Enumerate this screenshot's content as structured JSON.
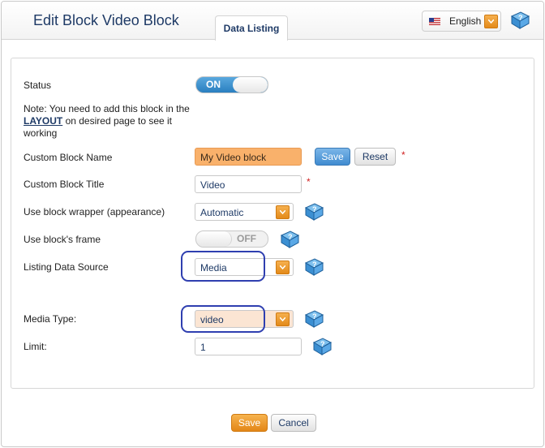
{
  "header": {
    "title": "Edit Block Video Block",
    "tab_label": "Data Listing",
    "language": {
      "label": "English",
      "flag": "us-flag-icon"
    }
  },
  "form": {
    "status": {
      "label": "Status",
      "value": "ON"
    },
    "note": {
      "prefix": "Note: You need to add this block in the",
      "link_text": "LAYOUT",
      "suffix": "on desired page to see it working"
    },
    "block_name": {
      "label": "Custom Block Name",
      "value": "My Video block",
      "save_label": "Save",
      "reset_label": "Reset",
      "required_mark": "*"
    },
    "block_title": {
      "label": "Custom Block Title",
      "value": "Video",
      "required_mark": "*"
    },
    "wrapper": {
      "label": "Use block wrapper (appearance)",
      "value": "Automatic"
    },
    "frame": {
      "label": "Use block's frame",
      "value": "OFF"
    },
    "data_source": {
      "label": "Listing Data Source",
      "value": "Media"
    },
    "media_type": {
      "label": "Media Type:",
      "value": "video"
    },
    "limit": {
      "label": "Limit:",
      "value": "1"
    }
  },
  "footer": {
    "save_label": "Save",
    "cancel_label": "Cancel"
  },
  "colors": {
    "accent_orange": "#e38617",
    "accent_blue": "#2a7fc0",
    "title_navy": "#1e3a66",
    "highlight_ring": "#2f3fb0"
  }
}
